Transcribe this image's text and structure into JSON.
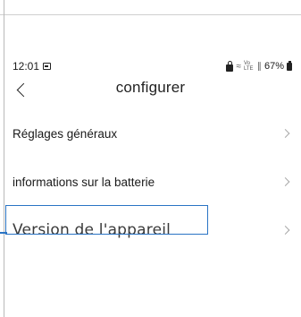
{
  "status_bar": {
    "time": "12:01",
    "wifi_label": "≈",
    "volte_label": "Vo LTE",
    "signal_label": "∥",
    "battery_percent": "67%"
  },
  "header": {
    "title": "configurer",
    "back_glyph": ""
  },
  "menu": {
    "items": [
      {
        "label": "Réglages généraux"
      },
      {
        "label": "informations sur la batterie"
      },
      {
        "label": "Version de l'appareil"
      }
    ]
  },
  "colors": {
    "highlight": "#2a74c4",
    "chevron": "#a8a8a8"
  },
  "icons": [
    "image-icon",
    "lock-icon",
    "wifi-icon",
    "volte-icon",
    "signal-icon",
    "battery-icon",
    "back-arrow-icon",
    "chevron-right-icon"
  ]
}
